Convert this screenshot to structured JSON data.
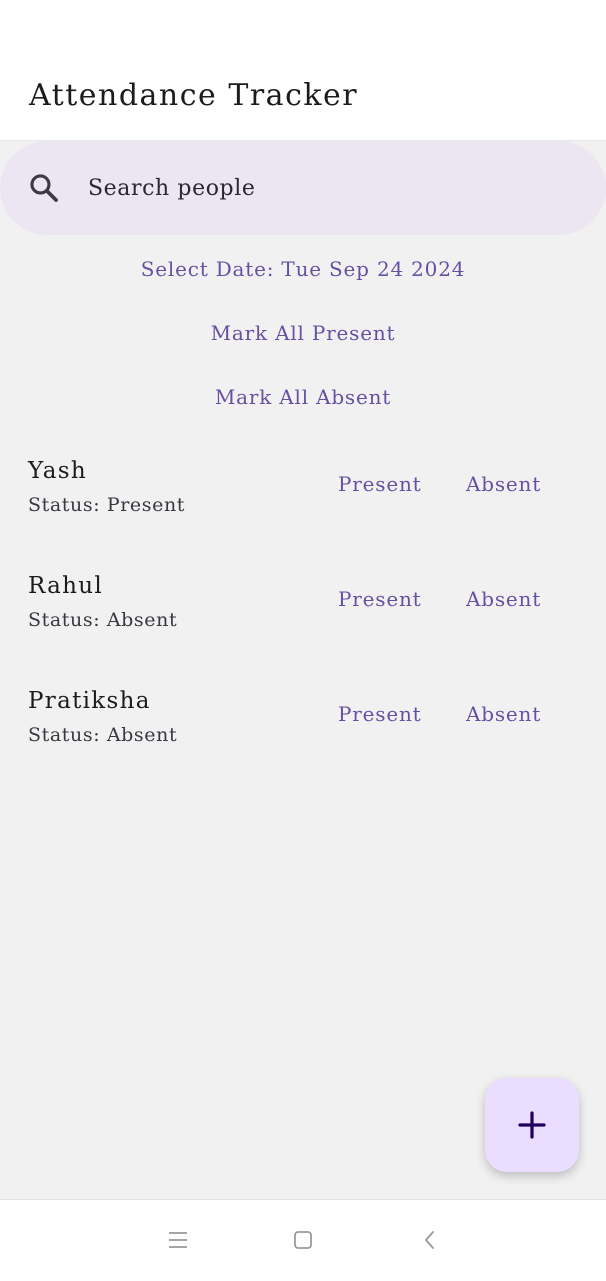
{
  "app_bar": {
    "title": "Attendance Tracker"
  },
  "search": {
    "placeholder": "Search people",
    "value": "",
    "icon": "search-icon"
  },
  "actions": {
    "select_date": "Select Date: Tue Sep 24 2024",
    "mark_all_present": "Mark All Present",
    "mark_all_absent": "Mark All Absent"
  },
  "people": [
    {
      "name": "Yash",
      "status": "Status: Present",
      "present_label": "Present",
      "absent_label": "Absent"
    },
    {
      "name": "Rahul",
      "status": "Status: Absent",
      "present_label": "Present",
      "absent_label": "Absent"
    },
    {
      "name": "Pratiksha",
      "status": "Status: Absent",
      "present_label": "Present",
      "absent_label": "Absent"
    }
  ],
  "fab": {
    "icon": "plus-icon"
  },
  "nav_bar": {
    "icons": [
      "menu-icon",
      "home-square-icon",
      "back-chevron-icon"
    ]
  },
  "colors": {
    "accent": "#6750a4",
    "search_background": "#ece6f3",
    "fab_background": "#eaddff",
    "page_background": "#f1f1f1",
    "app_bar_background": "#ffffff"
  }
}
